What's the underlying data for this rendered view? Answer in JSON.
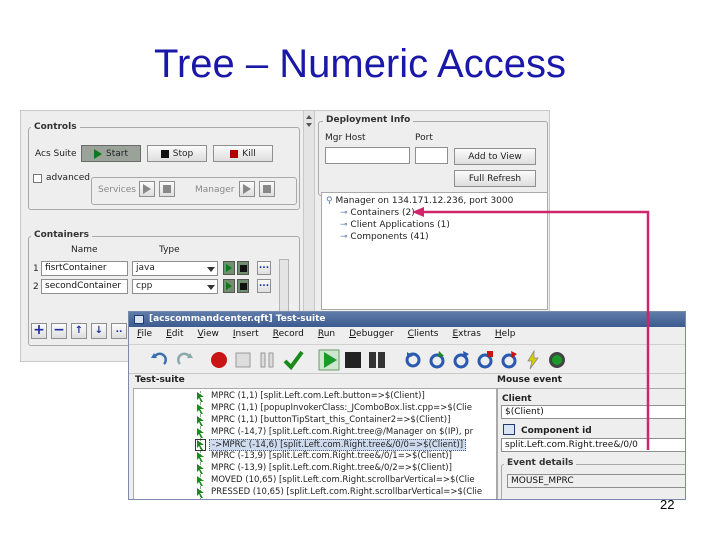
{
  "slide": {
    "title": "Tree – Numeric Access",
    "page_number": "22"
  },
  "colors": {
    "title": "#1a18a8",
    "arrow": "#d0246c",
    "selection": "#cfdcef",
    "titlebar": "#4b6a9c"
  },
  "controls": {
    "legend": "Controls",
    "acs_suite_label": "Acs Suite",
    "start_label": "Start",
    "stop_label": "Stop",
    "kill_label": "Kill",
    "advanced_label": "advanced",
    "services_label": "Services",
    "manager_label": "Manager"
  },
  "containers": {
    "legend": "Containers",
    "col_name": "Name",
    "col_type": "Type",
    "rows": [
      {
        "index": "1",
        "name": "fisrtContainer",
        "type": "java"
      },
      {
        "index": "2",
        "name": "secondContainer",
        "type": "cpp"
      }
    ],
    "dots": "..."
  },
  "deployment": {
    "legend": "Deployment Info",
    "mgr_host_label": "Mgr Host",
    "port_label": "Port",
    "add_to_view": "Add to View",
    "full_refresh": "Full Refresh",
    "tree": [
      "Manager on 134.171.12.236, port 3000",
      "Containers (2)",
      "Client Applications (1)",
      "Components (41)"
    ]
  },
  "testsuite": {
    "window_title": "[acscommandcenter.qft] Test-suite",
    "menus": [
      {
        "first": "F",
        "rest": "ile"
      },
      {
        "first": "E",
        "rest": "dit"
      },
      {
        "first": "V",
        "rest": "iew"
      },
      {
        "first": "I",
        "rest": "nsert"
      },
      {
        "first": "R",
        "rest": "ecord"
      },
      {
        "first": "R",
        "rest": "un"
      },
      {
        "first": "D",
        "rest": "ebugger"
      },
      {
        "first": "C",
        "rest": "lients"
      },
      {
        "first": "E",
        "rest": "xtras"
      },
      {
        "first": "H",
        "rest": "elp"
      }
    ],
    "tree_label": "Test-suite",
    "rows": [
      "MPRC (1,1) [split.Left.com.Left.button=>$(Client)]",
      "MPRC (1,1) [popupInvokerClass:_JComboBox.list.cpp=>$(Clie",
      "MPRC (1,1) [buttonTipStart_this_Container2=>$(Client)]",
      "MPRC (-14,7) [split.Left.com.Right.tree@/Manager on $(IP), pr",
      "->MPRC (-14,6) [split.Left.com.Right.tree&/0/0=>$(Client)]",
      "MPRC (-13,9) [split.Left.com.Right.tree&/0/1=>$(Client)]",
      "MPRC (-13,9) [split.Left.com.Right.tree&/0/2=>$(Client)]",
      "MOVED (10,65) [split.Left.com.Right.scrollbarVertical=>$(Clie",
      "PRESSED (10,65) [split.Left.com.Right.scrollbarVertical=>$(Clie"
    ],
    "selected_row_index": 4,
    "right": {
      "title": "Mouse event",
      "client_label": "Client",
      "client_value": "$(Client)",
      "component_id_label": "Component id",
      "component_id_value": "split.Left.com.Right.tree&/0/0",
      "event_details_label": "Event details",
      "event_value": "MOUSE_MPRC"
    }
  }
}
